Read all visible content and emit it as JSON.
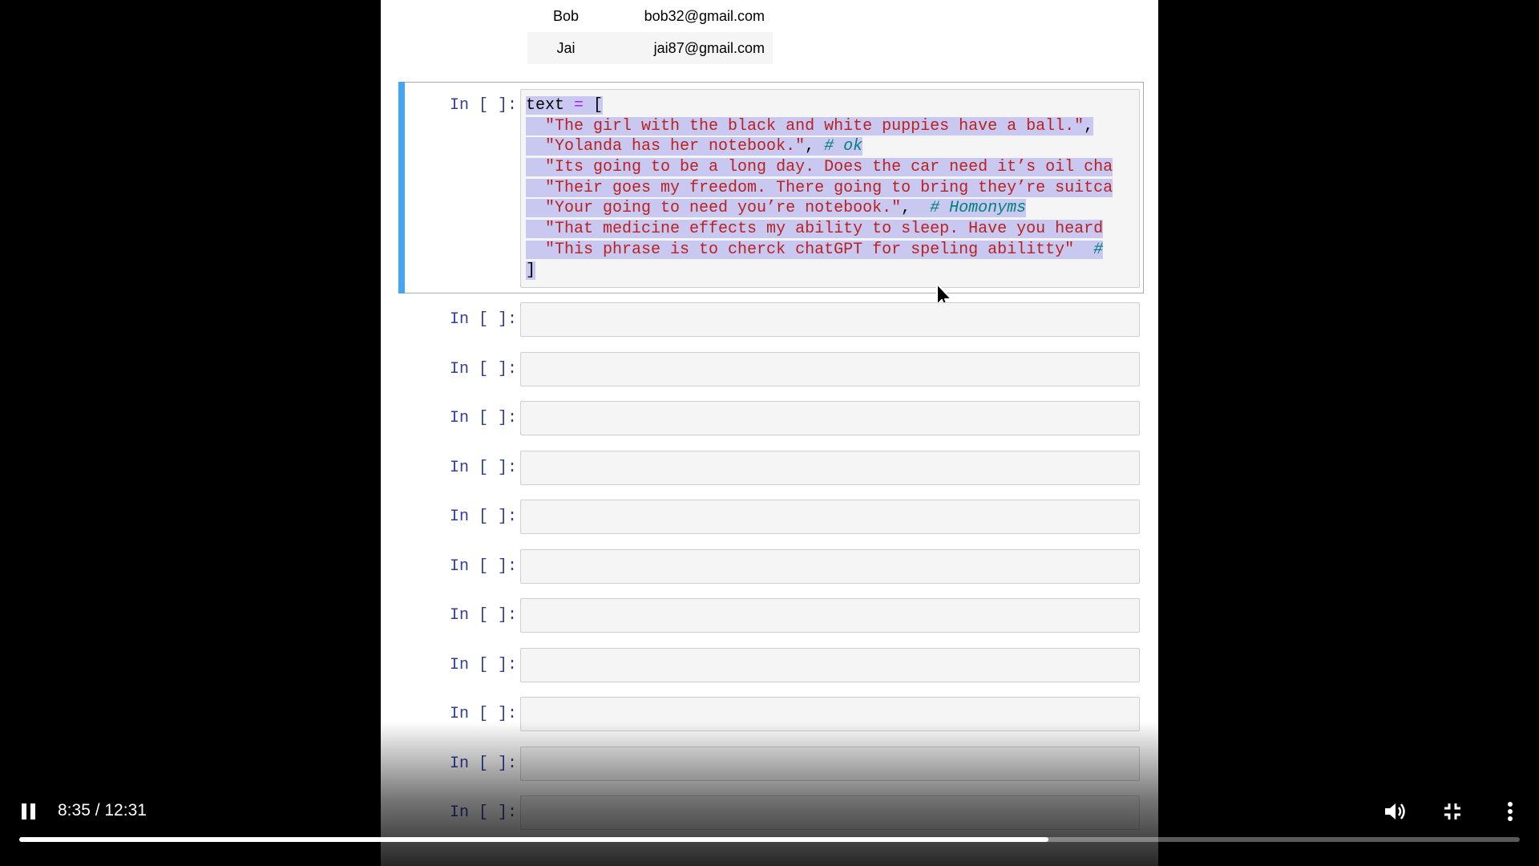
{
  "table": {
    "rows": [
      {
        "name": "Bob",
        "email": "bob32@gmail.com"
      },
      {
        "name": "Jai",
        "email": "jai87@gmail.com"
      }
    ]
  },
  "cells": {
    "prompt_label": "In [ ]:",
    "empty_count": 11
  },
  "code": {
    "lines": [
      [
        {
          "t": "text",
          "c": "kw-var"
        },
        {
          "t": " ",
          "c": "pun"
        },
        {
          "t": "=",
          "c": "op"
        },
        {
          "t": " [",
          "c": "pun"
        }
      ],
      [
        {
          "t": "  ",
          "c": "pun"
        },
        {
          "t": "\"The girl with the black and white puppies have a ball.\"",
          "c": "str"
        },
        {
          "t": ",",
          "c": "pun"
        }
      ],
      [
        {
          "t": "  ",
          "c": "pun"
        },
        {
          "t": "\"Yolanda has her notebook.\"",
          "c": "str"
        },
        {
          "t": ", ",
          "c": "pun"
        },
        {
          "t": "# ok",
          "c": "com"
        }
      ],
      [
        {
          "t": "  ",
          "c": "pun"
        },
        {
          "t": "\"Its going to be a long day. Does the car need it’s oil cha",
          "c": "str"
        }
      ],
      [
        {
          "t": "  ",
          "c": "pun"
        },
        {
          "t": "\"Their goes my freedom. There going to bring they’re suitca",
          "c": "str"
        }
      ],
      [
        {
          "t": "  ",
          "c": "pun"
        },
        {
          "t": "\"Your going to need you’re notebook.\"",
          "c": "str"
        },
        {
          "t": ",  ",
          "c": "pun"
        },
        {
          "t": "# Homonyms",
          "c": "com"
        }
      ],
      [
        {
          "t": "  ",
          "c": "pun"
        },
        {
          "t": "\"That medicine effects my ability to sleep. Have you heard",
          "c": "str"
        }
      ],
      [
        {
          "t": "  ",
          "c": "pun"
        },
        {
          "t": "\"This phrase is to cherck chatGPT for speling abilitty\"",
          "c": "str"
        },
        {
          "t": "  ",
          "c": "pun"
        },
        {
          "t": "#",
          "c": "com"
        }
      ],
      [
        {
          "t": "]",
          "c": "pun"
        }
      ]
    ]
  },
  "player": {
    "current_time": "8:35",
    "duration": "12:31",
    "time_label": "8:35 / 12:31",
    "progress_fraction": 0.686,
    "icons": {
      "play_state": "pause-icon",
      "volume": "volume-icon",
      "fullscreen": "exit-fullscreen-icon",
      "more": "more-vert-icon"
    }
  }
}
